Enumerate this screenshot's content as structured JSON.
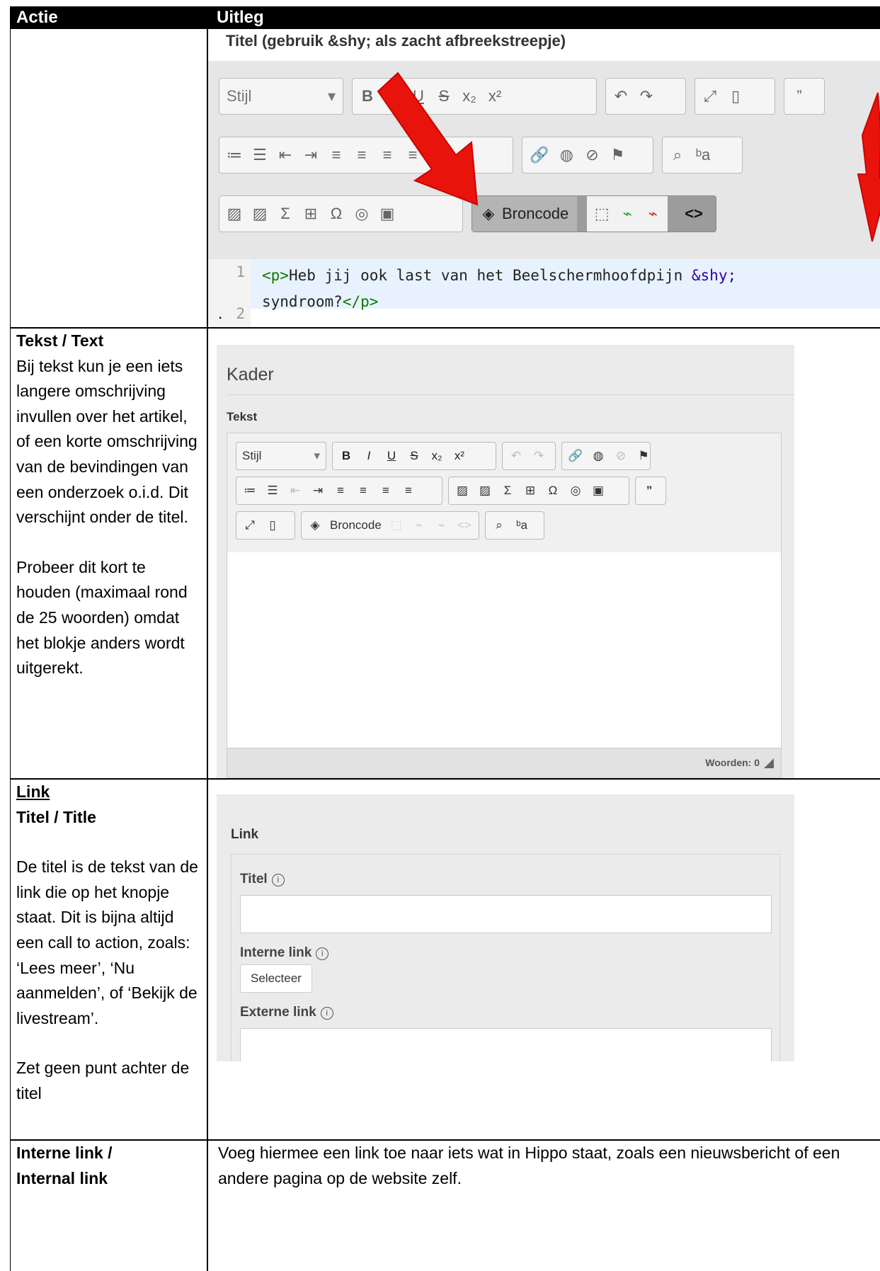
{
  "table": {
    "headers": [
      "Actie",
      "Uitleg"
    ],
    "rows": [
      {
        "left": "",
        "right_after": "."
      },
      {
        "left_title": "Tekst / Text",
        "left_paragraphs": [
          "Bij tekst kun je een iets langere omschrijving invullen over het artikel, of een korte omschrijving van de bevindingen van een onderzoek o.i.d. Dit verschijnt onder de titel.",
          "Probeer dit  kort te houden (maximaal rond de 25 woorden) omdat het blokje anders wordt uitgerekt."
        ]
      },
      {
        "left_heading": "Link",
        "left_title": "Titel / Title",
        "left_paragraphs": [
          "De titel is de tekst van de link die op het knopje staat. Dit is bijna altijd een call to action, zoals: ‘Lees meer’, ‘Nu aanmelden’, of ‘Bekijk de livestream’.",
          "Zet geen punt achter de titel"
        ]
      },
      {
        "left_title_1": "Interne link /",
        "left_title_2": "Internal link",
        "right_text": "Voeg hiermee een link toe naar iets wat in Hippo staat, zoals een nieuwsbericht of een andere pagina op de website zelf."
      }
    ]
  },
  "screenshot1": {
    "field_title": "Titel (gebruik &shy; als zacht afbreekstreepje)",
    "style_select": "Stijl",
    "source_button": "Broncode",
    "code_line1": "<p>Heb jij ook last van het Beelschermhoofdpijn  &shy;",
    "code_line2": "syndroom?</p>",
    "line_numbers": [
      "1",
      "2"
    ],
    "arrow_color": "#e8140c"
  },
  "screenshot2": {
    "section_title": "Kader",
    "field_label": "Tekst",
    "style_select": "Stijl",
    "source_button": "Broncode",
    "word_count": "Woorden: 0"
  },
  "screenshot3": {
    "section_title": "Link",
    "title_label": "Titel",
    "internal_label": "Interne link",
    "select_button": "Selecteer",
    "external_label": "Externe link",
    "info_glyph": "i"
  }
}
